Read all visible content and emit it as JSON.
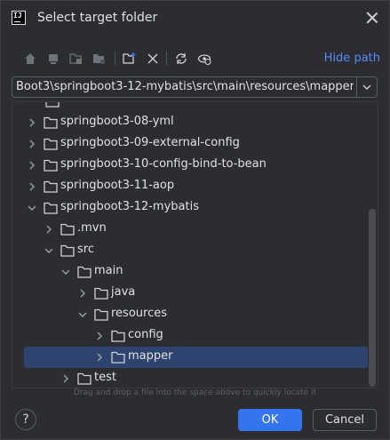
{
  "dialog": {
    "title": "Select target folder",
    "app_icon_text": "IJ"
  },
  "toolbar": {
    "icons": [
      "home-icon",
      "desktop-icon",
      "project-icon",
      "module-icon",
      "new-folder-icon",
      "delete-icon",
      "refresh-icon",
      "show-hidden-icon"
    ],
    "hide_path_label": "Hide path"
  },
  "path": {
    "value": "Boot3\\springboot3-12-mybatis\\src\\main\\resources\\mapper"
  },
  "tree": {
    "items": [
      {
        "label": "springboot3-08-yml",
        "expanded": false,
        "selected": false
      },
      {
        "label": "springboot3-09-external-config",
        "expanded": false,
        "selected": false
      },
      {
        "label": "springboot3-10-config-bind-to-bean",
        "expanded": false,
        "selected": false
      },
      {
        "label": "springboot3-11-aop",
        "expanded": false,
        "selected": false
      },
      {
        "label": "springboot3-12-mybatis",
        "expanded": true,
        "selected": false
      },
      {
        "label": ".mvn",
        "expanded": false,
        "selected": false
      },
      {
        "label": "src",
        "expanded": true,
        "selected": false
      },
      {
        "label": "main",
        "expanded": true,
        "selected": false
      },
      {
        "label": "java",
        "expanded": false,
        "selected": false
      },
      {
        "label": "resources",
        "expanded": true,
        "selected": false
      },
      {
        "label": "config",
        "expanded": false,
        "selected": false
      },
      {
        "label": "mapper",
        "expanded": false,
        "selected": true
      },
      {
        "label": "test",
        "expanded": false,
        "selected": false
      }
    ]
  },
  "hint": "Drag and drop a file into the space above to quickly locate it",
  "buttons": {
    "help": "?",
    "ok": "OK",
    "cancel": "Cancel"
  },
  "colors": {
    "background": "#2b2d30",
    "selection": "#2e436e",
    "accent": "#3574f0",
    "link": "#548af7"
  }
}
